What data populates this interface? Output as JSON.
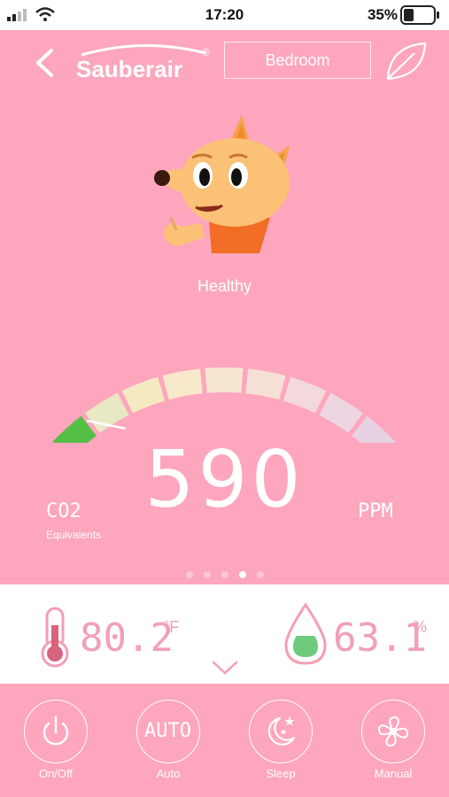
{
  "status_bar": {
    "time": "17:20",
    "battery_percent": "35%"
  },
  "header": {
    "brand": "Sauberair",
    "brand_mark": "®",
    "room": "Bedroom"
  },
  "air_quality": {
    "status": "Healthy",
    "value": "590",
    "pollutant": "CO2",
    "pollutant_sub": "Equivalents",
    "unit": "PPM",
    "gauge_level": 0.18,
    "pages": 5,
    "active_page": 3
  },
  "sensors": {
    "temperature": {
      "value": "80.2",
      "unit": "°F"
    },
    "humidity": {
      "value": "63.1",
      "unit": "%"
    }
  },
  "controls": [
    {
      "label": "On/Off",
      "icon": "power-icon"
    },
    {
      "label": "Auto",
      "icon": "auto-icon",
      "icon_text": "AUTO"
    },
    {
      "label": "Sleep",
      "icon": "moon-stars-icon"
    },
    {
      "label": "Manual",
      "icon": "fan-icon"
    }
  ],
  "colors": {
    "background": "#fda6bd",
    "accent": "#f39fb6",
    "gauge_active": "#39b93a"
  }
}
